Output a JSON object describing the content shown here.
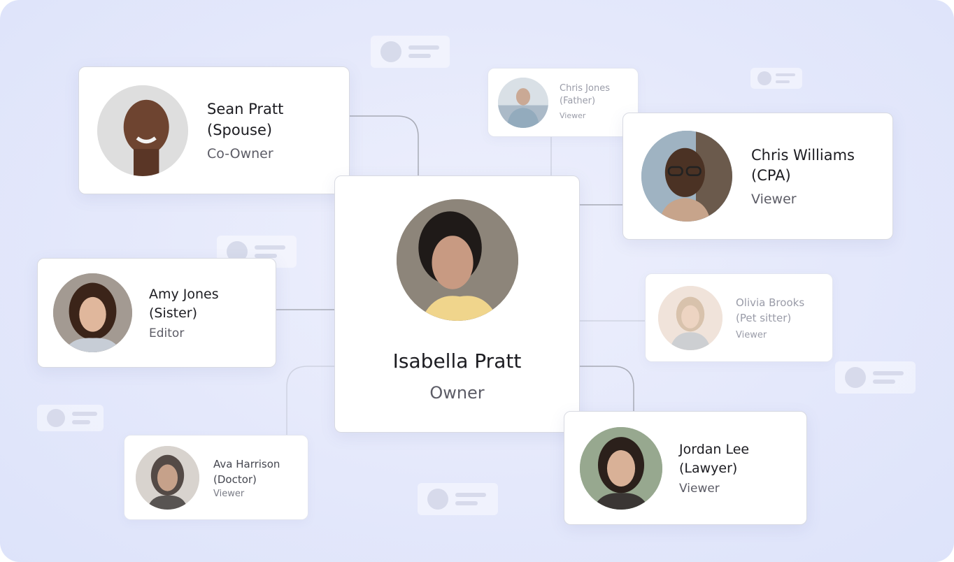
{
  "center": {
    "name": "Isabella Pratt",
    "role": "Owner",
    "avatar": "person-portrait"
  },
  "members": [
    {
      "key": "sean",
      "name": "Sean Pratt",
      "relation": "(Spouse)",
      "role": "Co-Owner",
      "avatar": "person-portrait"
    },
    {
      "key": "chris-jones",
      "name": "Chris Jones",
      "relation": "(Father)",
      "role": "Viewer",
      "avatar": "person-portrait"
    },
    {
      "key": "chris-williams",
      "name": "Chris Williams",
      "relation": "(CPA)",
      "role": "Viewer",
      "avatar": "person-portrait"
    },
    {
      "key": "amy",
      "name": "Amy Jones",
      "relation": "(Sister)",
      "role": "Editor",
      "avatar": "person-portrait"
    },
    {
      "key": "olivia",
      "name": "Olivia Brooks",
      "relation": "(Pet sitter)",
      "role": "Viewer",
      "avatar": "person-portrait"
    },
    {
      "key": "ava",
      "name": "Ava Harrison",
      "relation": "(Doctor)",
      "role": "Viewer",
      "avatar": "person-portrait"
    },
    {
      "key": "jordan",
      "name": "Jordan Lee",
      "relation": "(Lawyer)",
      "role": "Viewer",
      "avatar": "person-portrait"
    }
  ],
  "colors": {
    "background": "#e4e8fb",
    "card": "#ffffff",
    "connector": "#a8abb6",
    "text_primary": "#1c1c21",
    "text_secondary": "#5c5c66"
  }
}
